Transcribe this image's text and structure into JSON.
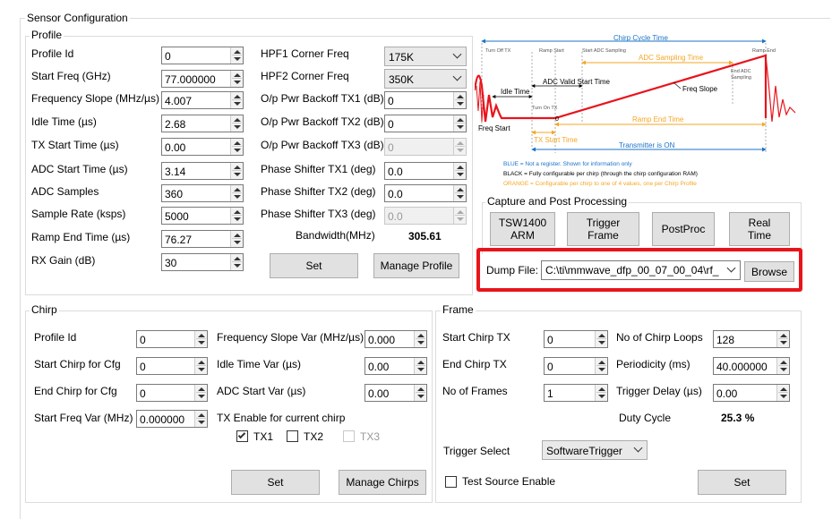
{
  "window_title": "Sensor Configuration",
  "profile": {
    "title": "Profile",
    "left_fields": [
      {
        "label": "Profile Id",
        "value": "0"
      },
      {
        "label": "Start Freq (GHz)",
        "value": "77.000000"
      },
      {
        "label": "Frequency Slope (MHz/µs)",
        "value": "4.007"
      },
      {
        "label": "Idle Time (µs)",
        "value": "2.68"
      },
      {
        "label": "TX Start Time (µs)",
        "value": "0.00"
      },
      {
        "label": "ADC Start Time (µs)",
        "value": "3.14"
      },
      {
        "label": "ADC Samples",
        "value": "360"
      },
      {
        "label": "Sample Rate (ksps)",
        "value": "5000"
      },
      {
        "label": "Ramp End Time (µs)",
        "value": "76.27"
      },
      {
        "label": "RX Gain (dB)",
        "value": "30"
      }
    ],
    "hpf1": {
      "label": "HPF1 Corner Freq",
      "value": "175K"
    },
    "hpf2": {
      "label": "HPF2 Corner Freq",
      "value": "350K"
    },
    "right_fields": [
      {
        "label": "O/p Pwr Backoff TX1 (dB)",
        "value": "0"
      },
      {
        "label": "O/p Pwr Backoff TX2 (dB)",
        "value": "0"
      },
      {
        "label": "O/p Pwr Backoff TX3 (dB)",
        "value": "0"
      },
      {
        "label": "Phase Shifter TX1 (deg)",
        "value": "0.0"
      },
      {
        "label": "Phase Shifter TX2 (deg)",
        "value": "0.0"
      },
      {
        "label": "Phase Shifter TX3 (deg)",
        "value": "0.0"
      }
    ],
    "bandwidth_label": "Bandwidth(MHz)",
    "bandwidth_value": "305.61",
    "set_label": "Set",
    "manage_label": "Manage Profile"
  },
  "diagram": {
    "chirp_cycle_time": "Chirp Cycle Time",
    "turn_off_tx": "Turn Off TX",
    "ramp_start": "Ramp Start",
    "start_adc_sampling": "Start ADC Sampling",
    "adc_sampling_time": "ADC Sampling Time",
    "ramp_end": "Ramp End",
    "end_adc_sampling_1": "End ADC",
    "end_adc_sampling_2": "Sampling",
    "idle_time": "Idle Time",
    "adc_valid_start_time": "ADC Valid Start Time",
    "freq_slope": "Freq Slope",
    "turn_on_tx": "Turn On TX",
    "zero": "0",
    "freq_start": "Freq Start",
    "ramp_end_time": "Ramp End Time",
    "tx_start_time": "TX Start Time",
    "transmitter_on": "Transmitter is ON",
    "legend_blue": "BLUE = Not a register. Shown for information only",
    "legend_black": "BLACK = Fully configurable per chirp (through the chirp configuration RAM)",
    "legend_orange": "ORANGE = Configurable per chirp to one of 4 values, one per Chirp Profile"
  },
  "capture": {
    "title": "Capture and Post Processing",
    "tsw1": "TSW1400",
    "tsw2": "ARM",
    "trig1": "Trigger",
    "trig2": "Frame",
    "postproc": "PostProc",
    "rt1": "Real",
    "rt2": "Time",
    "dump_label": "Dump File:",
    "dump_value": "C:\\ti\\mmwave_dfp_00_07_00_04\\rf_",
    "browse": "Browse"
  },
  "chirp": {
    "title": "Chirp",
    "left_fields": [
      {
        "label": "Profile Id",
        "value": "0"
      },
      {
        "label": "Start Chirp for Cfg",
        "value": "0"
      },
      {
        "label": "End Chirp for Cfg",
        "value": "0"
      },
      {
        "label": "Start Freq Var (MHz)",
        "value": "0.000000"
      }
    ],
    "right_fields": [
      {
        "label": "Frequency Slope Var (MHz/µs)",
        "value": "0.000"
      },
      {
        "label": "Idle Time Var (µs)",
        "value": "0.00"
      },
      {
        "label": "ADC Start Var (µs)",
        "value": "0.00"
      }
    ],
    "tx_enable_label": "TX Enable for current chirp",
    "tx1": "TX1",
    "tx2": "TX2",
    "tx3": "TX3",
    "set_label": "Set",
    "manage_label": "Manage Chirps"
  },
  "frame": {
    "title": "Frame",
    "left_fields": [
      {
        "label": "Start Chirp TX",
        "value": "0"
      },
      {
        "label": "End Chirp TX",
        "value": "0"
      },
      {
        "label": "No of Frames",
        "value": "1"
      }
    ],
    "right_fields": [
      {
        "label": "No of Chirp Loops",
        "value": "128"
      },
      {
        "label": "Periodicity (ms)",
        "value": "40.000000"
      },
      {
        "label": "Trigger Delay (µs)",
        "value": "0.00"
      }
    ],
    "duty_cycle_label": "Duty Cycle",
    "duty_cycle_value": "25.3 %",
    "trigger_select_label": "Trigger Select",
    "trigger_select_value": "SoftwareTrigger",
    "test_source_label": "Test Source Enable",
    "set_label": "Set"
  },
  "colors": {
    "highlight_red": "#e8141c",
    "diagram_blue": "#1a73c8",
    "diagram_orange": "#f5a623"
  }
}
